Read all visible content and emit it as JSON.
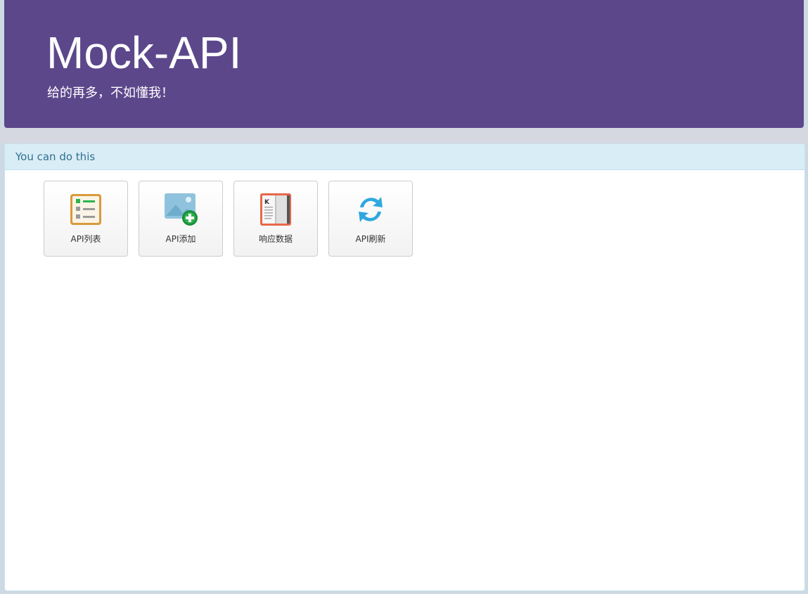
{
  "header": {
    "title": "Mock-API",
    "subtitle": "给的再多，不如懂我！"
  },
  "panel": {
    "heading": "You can do this",
    "tiles": [
      {
        "label": "API列表",
        "icon": "list-icon"
      },
      {
        "label": "API添加",
        "icon": "image-add-icon"
      },
      {
        "label": "响应数据",
        "icon": "book-icon"
      },
      {
        "label": "API刷新",
        "icon": "refresh-icon"
      }
    ]
  },
  "colors": {
    "header_bg": "#5c478b",
    "panel_heading_bg": "#d9edf7",
    "panel_heading_text": "#31708f"
  }
}
